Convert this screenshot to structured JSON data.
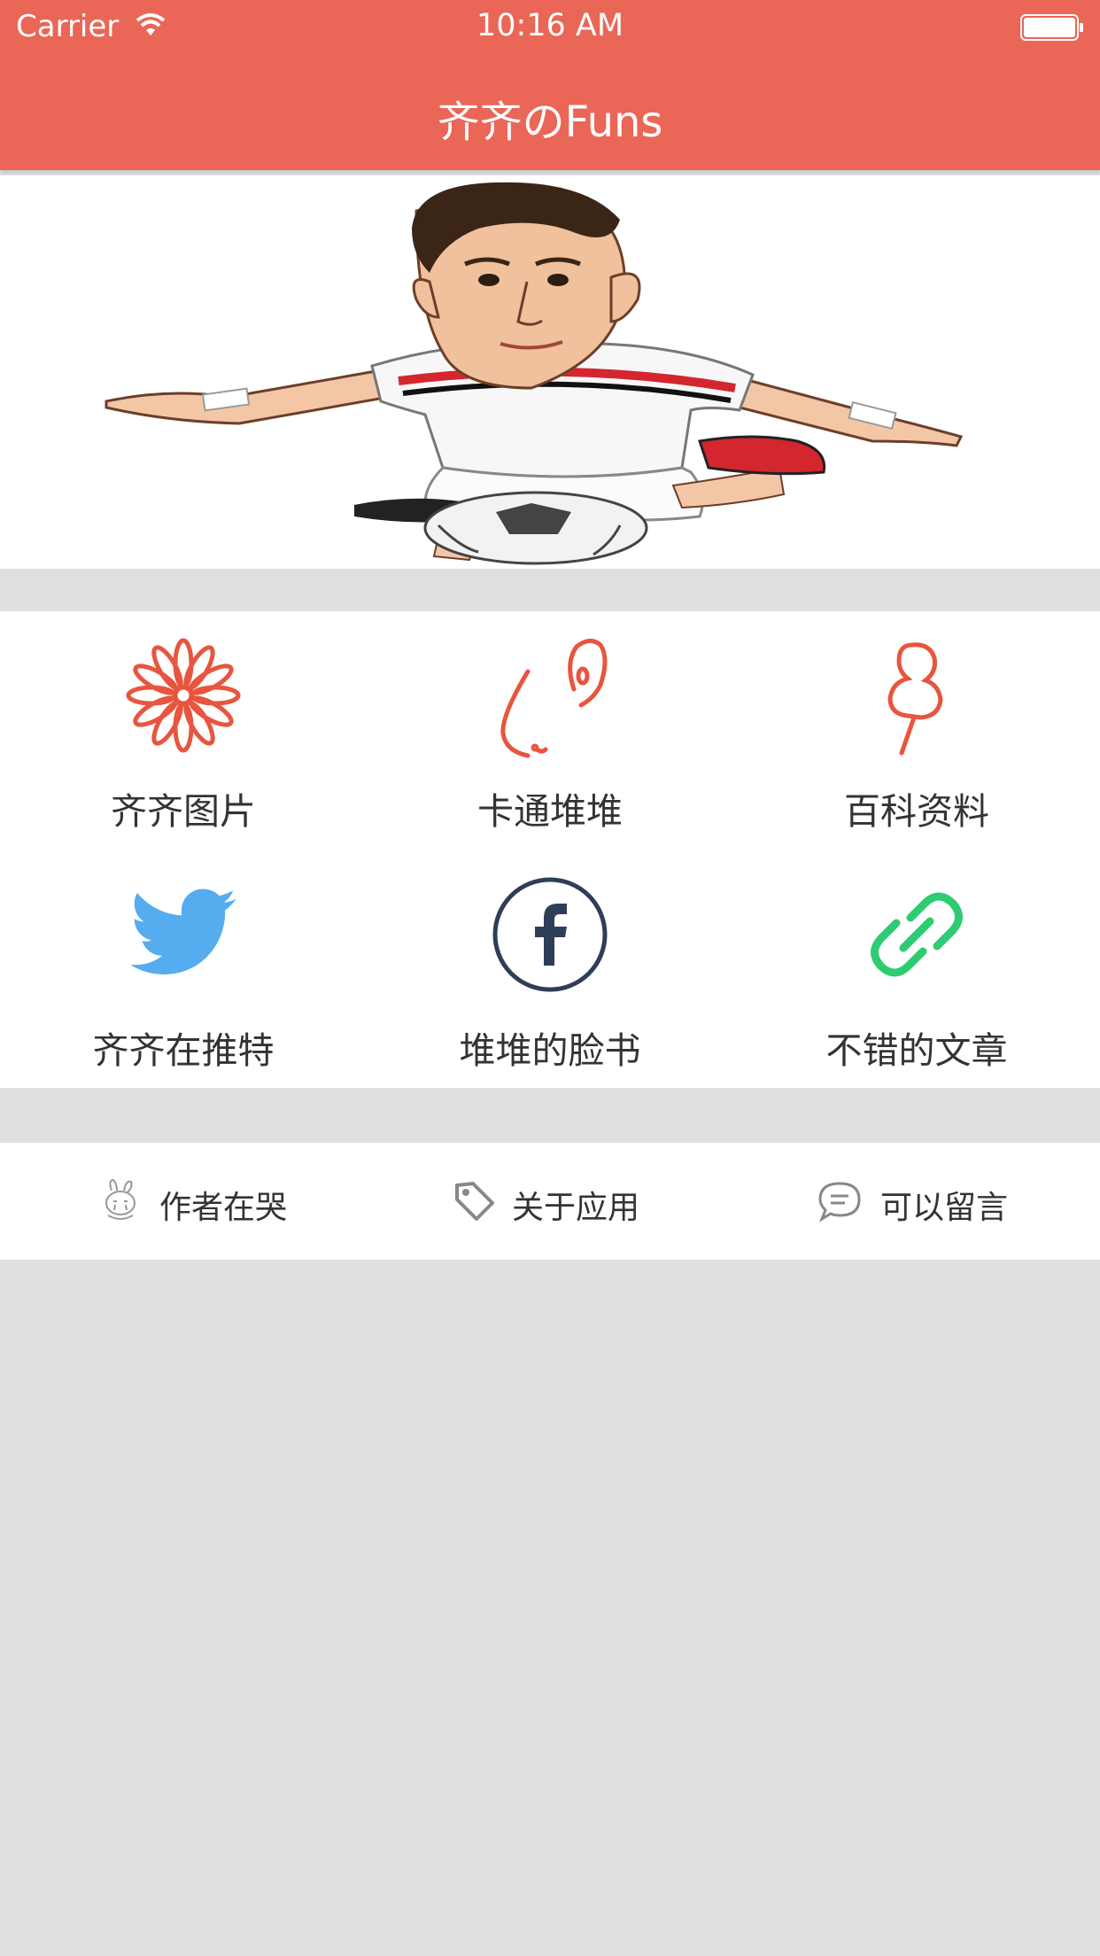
{
  "status_bar": {
    "carrier": "Carrier",
    "time": "10:16 AM"
  },
  "nav": {
    "title": "齐齐のFuns",
    "bar_color": "#ea6656"
  },
  "hero": {
    "image": "cartoon-soccer-player-illustration"
  },
  "grid": {
    "items": [
      {
        "label": "齐齐图片",
        "icon": "flower-icon",
        "color": "#e8553f"
      },
      {
        "label": "卡通堆堆",
        "icon": "nose-ear-icon",
        "color": "#e8553f"
      },
      {
        "label": "百科资料",
        "icon": "map-pin-icon",
        "color": "#e8553f"
      },
      {
        "label": "齐齐在推特",
        "icon": "twitter-icon",
        "color": "#55acee"
      },
      {
        "label": "堆堆的脸书",
        "icon": "facebook-icon",
        "color": "#2e3e58"
      },
      {
        "label": "不错的文章",
        "icon": "link-icon",
        "color": "#2ecc71"
      }
    ]
  },
  "footer": {
    "items": [
      {
        "label": "作者在哭",
        "icon": "crying-bunny-icon"
      },
      {
        "label": "关于应用",
        "icon": "tag-icon"
      },
      {
        "label": "可以留言",
        "icon": "chat-bubble-icon"
      }
    ]
  }
}
